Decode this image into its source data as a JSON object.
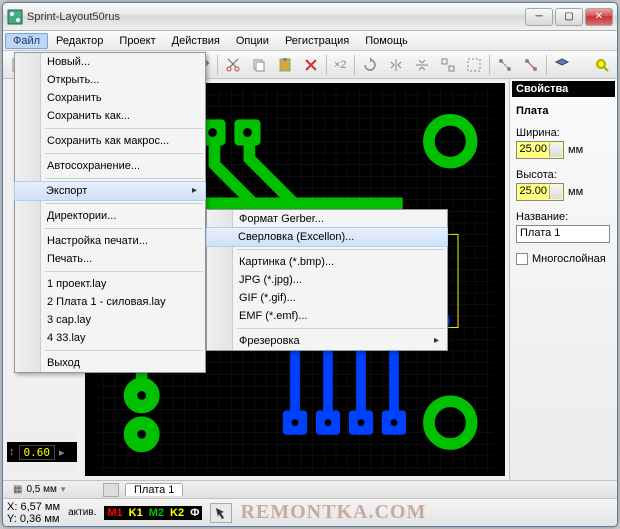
{
  "window": {
    "title": "Sprint-Layout50rus"
  },
  "menubar": [
    "Файл",
    "Редактор",
    "Проект",
    "Действия",
    "Опции",
    "Регистрация",
    "Помощь"
  ],
  "toolbar_x2": "×2",
  "file_menu": {
    "items": [
      {
        "l": "Новый..."
      },
      {
        "l": "Открыть..."
      },
      {
        "l": "Сохранить"
      },
      {
        "l": "Сохранить как..."
      },
      {
        "sep": true
      },
      {
        "l": "Сохранить как макрос..."
      },
      {
        "sep": true
      },
      {
        "l": "Автосохранение..."
      },
      {
        "sep": true
      },
      {
        "l": "Экспорт",
        "sub": true,
        "hl": true
      },
      {
        "sep": true
      },
      {
        "l": "Директории..."
      },
      {
        "sep": true
      },
      {
        "l": "Настройка печати..."
      },
      {
        "l": "Печать..."
      },
      {
        "sep": true
      },
      {
        "l": "1 проект.lay"
      },
      {
        "l": "2 Плата 1 - силовая.lay"
      },
      {
        "l": "3 cap.lay"
      },
      {
        "l": "4 33.lay"
      },
      {
        "sep": true
      },
      {
        "l": "Выход"
      }
    ]
  },
  "export_menu": {
    "items": [
      {
        "l": "Формат Gerber..."
      },
      {
        "l": "Сверловка (Excellon)...",
        "hl": true
      },
      {
        "sep": true
      },
      {
        "l": "Картинка (*.bmp)..."
      },
      {
        "l": "JPG (*.jpg)..."
      },
      {
        "l": "GIF (*.gif)..."
      },
      {
        "l": "EMF (*.emf)..."
      },
      {
        "sep": true
      },
      {
        "l": "Фрезеровка",
        "sub": true
      }
    ]
  },
  "props": {
    "header": "Свойства",
    "section": "Плата",
    "width_label": "Ширина:",
    "width_value": "25.00",
    "height_label": "Высота:",
    "height_value": "25.00",
    "unit": "мм",
    "name_label": "Название:",
    "name_value": "Плата 1",
    "multilayer": "Многослойная"
  },
  "left": {
    "slider_value": "0.60",
    "grid_value": "0,5 мм"
  },
  "tab": {
    "name": "Плата 1"
  },
  "status": {
    "x_label": "X:",
    "x_val": "6,57 мм",
    "y_label": "Y:",
    "y_val": "0,36 мм",
    "active": "актив.",
    "layers": [
      {
        "t": "M1",
        "c": "#ff0000"
      },
      {
        "t": "K1",
        "c": "#ffff00"
      },
      {
        "t": "M2",
        "c": "#00c000"
      },
      {
        "t": "K2",
        "c": "#ffff00"
      },
      {
        "t": "Ф",
        "c": "#ffffff"
      }
    ]
  },
  "watermark": "REMONTKA.COM"
}
